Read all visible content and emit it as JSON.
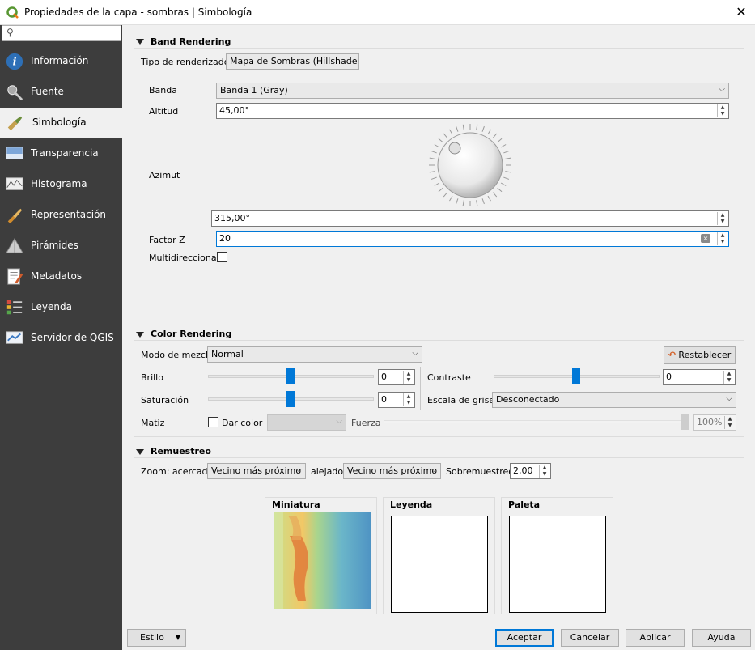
{
  "window": {
    "title": "Propiedades de la capa - sombras | Simbología",
    "close": "✕"
  },
  "sidebar": {
    "search_placeholder": "",
    "items": [
      {
        "label": "Información",
        "icon": "info-icon"
      },
      {
        "label": "Fuente",
        "icon": "source-icon"
      },
      {
        "label": "Simbología",
        "icon": "symbology-icon"
      },
      {
        "label": "Transparencia",
        "icon": "transparency-icon"
      },
      {
        "label": "Histograma",
        "icon": "histogram-icon"
      },
      {
        "label": "Representación",
        "icon": "rendering-icon"
      },
      {
        "label": "Pirámides",
        "icon": "pyramids-icon"
      },
      {
        "label": "Metadatos",
        "icon": "metadata-icon"
      },
      {
        "label": "Leyenda",
        "icon": "legend-icon"
      },
      {
        "label": "Servidor de QGIS",
        "icon": "server-icon"
      }
    ],
    "active_index": 2
  },
  "band_rendering": {
    "title": "Band Rendering",
    "renderer_label": "Tipo de renderizador",
    "renderer_value": "Mapa de Sombras (Hillshade)",
    "band_label": "Banda",
    "band_value": "Banda 1 (Gray)",
    "altitude_label": "Altitud",
    "altitude_value": "45,00°",
    "azimuth_label": "Azimut",
    "azimuth_value": "315,00°",
    "zfactor_label": "Factor Z",
    "zfactor_value": "20",
    "multidirectional_label": "Multidireccional",
    "multidirectional_checked": false
  },
  "color_rendering": {
    "title": "Color Rendering",
    "blend_label": "Modo de mezcla",
    "blend_value": "Normal",
    "reset_label": "Restablecer",
    "brightness_label": "Brillo",
    "brightness_value": "0",
    "contrast_label": "Contraste",
    "contrast_value": "0",
    "saturation_label": "Saturación",
    "saturation_value": "0",
    "grayscale_label": "Escala de grises",
    "grayscale_value": "Desconectado",
    "hue_label": "Matiz",
    "colorize_label": "Dar color",
    "strength_label": "Fuerza",
    "strength_value": "100%"
  },
  "resampling": {
    "title": "Remuestreo",
    "zoom_in_label": "Zoom: acercado",
    "zoom_in_value": "Vecino más próximo",
    "zoom_out_label": "alejado",
    "zoom_out_value": "Vecino más próximo",
    "oversampling_label": "Sobremuestreo",
    "oversampling_value": "2,00"
  },
  "previews": {
    "thumbnail": "Miniatura",
    "legend": "Leyenda",
    "palette": "Paleta"
  },
  "footer": {
    "style": "Estilo",
    "ok": "Aceptar",
    "cancel": "Cancelar",
    "apply": "Aplicar",
    "help": "Ayuda"
  }
}
